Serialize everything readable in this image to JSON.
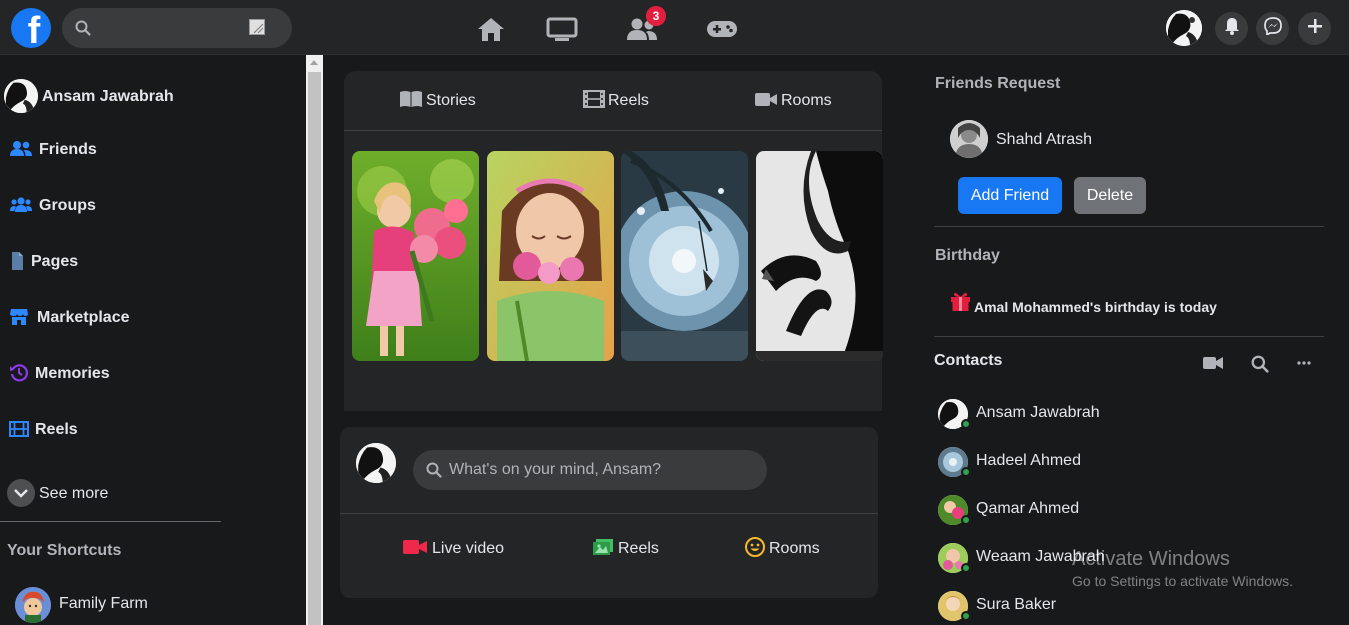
{
  "topbar": {
    "logo_letter": "f",
    "search_placeholder": "",
    "notifications_badge": "3"
  },
  "user": {
    "name": "Ansam Jawabrah"
  },
  "sidebar": {
    "items": [
      {
        "label": "Friends",
        "icon": "friends-icon"
      },
      {
        "label": "Groups",
        "icon": "groups-icon"
      },
      {
        "label": "Pages",
        "icon": "pages-icon"
      },
      {
        "label": "Marketplace",
        "icon": "marketplace-icon"
      },
      {
        "label": "Memories",
        "icon": "memories-icon"
      },
      {
        "label": "Reels",
        "icon": "reels-icon"
      }
    ],
    "see_more": "See more",
    "shortcuts_title": "Your Shortcuts",
    "shortcuts": [
      {
        "label": "Family Farm"
      }
    ]
  },
  "stories": {
    "tabs": [
      {
        "label": "Stories",
        "icon": "book-icon"
      },
      {
        "label": "Reels",
        "icon": "film-icon"
      },
      {
        "label": "Rooms",
        "icon": "video-camera-icon"
      }
    ]
  },
  "composer": {
    "placeholder": "What's on your mind, Ansam?",
    "actions": [
      {
        "label": "Live video",
        "icon": "live-video-icon",
        "color": "#f02849"
      },
      {
        "label": "Reels",
        "icon": "reels-icon",
        "color": "#45bd62"
      },
      {
        "label": "Rooms",
        "icon": "smiley-icon",
        "color": "#f7b928"
      }
    ]
  },
  "friend_request": {
    "title": "Friends Request",
    "name": "Shahd Atrash",
    "accept_label": "Add Friend",
    "delete_label": "Delete"
  },
  "birthday": {
    "title": "Birthday",
    "text": "Amal Mohammed's birthday is today"
  },
  "contacts": {
    "title": "Contacts",
    "list": [
      {
        "name": "Ansam Jawabrah"
      },
      {
        "name": "Hadeel Ahmed"
      },
      {
        "name": "Qamar Ahmed"
      },
      {
        "name": "Weaam Jawabrah"
      },
      {
        "name": "Sura Baker"
      }
    ]
  },
  "watermark": {
    "line1": "Activate Windows",
    "line2": "Go to Settings to activate Windows."
  },
  "colors": {
    "brand": "#1877f2",
    "badge": "#e41e3f",
    "online": "#31a24c"
  }
}
